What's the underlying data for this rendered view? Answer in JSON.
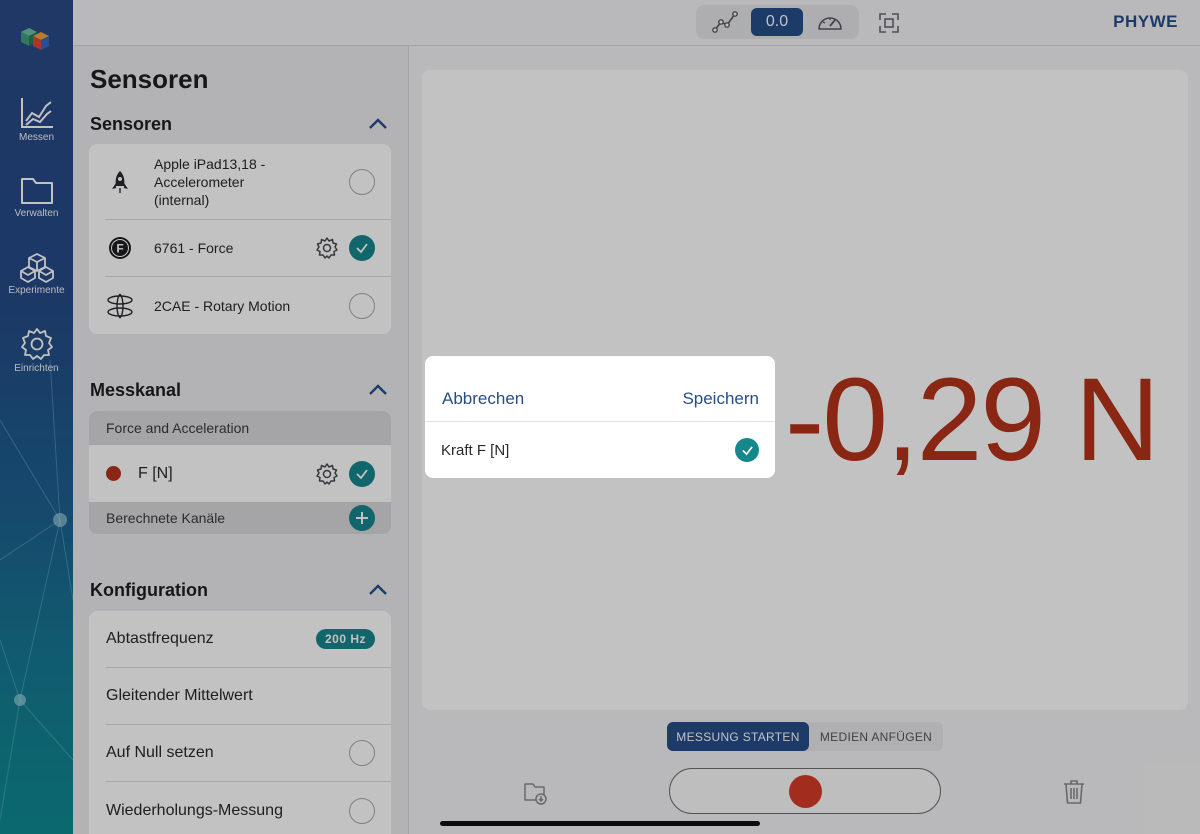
{
  "rail": {
    "items": [
      {
        "label": "Messen",
        "icon": "chart-icon"
      },
      {
        "label": "Verwalten",
        "icon": "folder-icon"
      },
      {
        "label": "Experimente",
        "icon": "cubes-icon"
      },
      {
        "label": "Einrichten",
        "icon": "gear-icon"
      }
    ]
  },
  "topbar": {
    "display_value": "0.0",
    "brand": "PHYWE"
  },
  "sidebar": {
    "title": "Sensoren",
    "sensors": {
      "heading": "Sensoren",
      "items": [
        {
          "name": "Apple iPad13,18 - Accelerometer (internal)",
          "selected": false
        },
        {
          "name": "6761 - Force",
          "selected": true
        },
        {
          "name": "2CAE - Rotary Motion",
          "selected": false
        }
      ]
    },
    "channel": {
      "heading": "Messkanal",
      "group": "Force and Acceleration",
      "item": "F [N]",
      "computed": "Berechnete Kanäle"
    },
    "config": {
      "heading": "Konfiguration",
      "rows": [
        {
          "label": "Abtastfrequenz",
          "badge": "200 Hz"
        },
        {
          "label": "Gleitender Mittelwert"
        },
        {
          "label": "Auf Null setzen"
        },
        {
          "label": "Wiederholungs-Messung"
        }
      ]
    }
  },
  "main": {
    "reading": "-0,29 N",
    "mode_start": "MESSUNG STARTEN",
    "mode_media": "MEDIEN ANFÜGEN"
  },
  "modal": {
    "cancel": "Abbrechen",
    "save": "Speichern",
    "option": "Kraft F [N]"
  },
  "colors": {
    "accent": "#264e8a",
    "teal": "#16878d",
    "reading": "#b4321b",
    "record": "#d53a27"
  }
}
